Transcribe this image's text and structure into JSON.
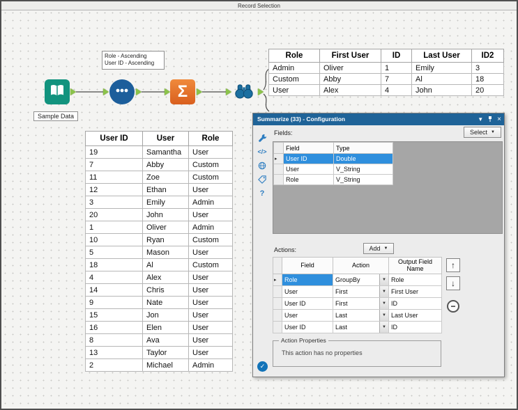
{
  "window": {
    "title": "Record Selection"
  },
  "workflow": {
    "input_tool_label": "Sample Data",
    "sort_annotation": "Role - Ascending\nUser ID - Ascending",
    "tools": [
      {
        "name": "input-data",
        "type": "Input Data"
      },
      {
        "name": "sort",
        "type": "Sort"
      },
      {
        "name": "summarize",
        "type": "Summarize"
      },
      {
        "name": "browse",
        "type": "Browse"
      }
    ]
  },
  "result_table": {
    "columns": [
      "Role",
      "First User",
      "ID",
      "Last User",
      "ID2"
    ],
    "rows": [
      [
        "Admin",
        "Oliver",
        "1",
        "Emily",
        "3"
      ],
      [
        "Custom",
        "Abby",
        "7",
        "Al",
        "18"
      ],
      [
        "User",
        "Alex",
        "4",
        "John",
        "20"
      ]
    ]
  },
  "data_table": {
    "columns": [
      "User ID",
      "User",
      "Role"
    ],
    "rows": [
      [
        "19",
        "Samantha",
        "User"
      ],
      [
        "7",
        "Abby",
        "Custom"
      ],
      [
        "11",
        "Zoe",
        "Custom"
      ],
      [
        "12",
        "Ethan",
        "User"
      ],
      [
        "3",
        "Emily",
        "Admin"
      ],
      [
        "20",
        "John",
        "User"
      ],
      [
        "1",
        "Oliver",
        "Admin"
      ],
      [
        "10",
        "Ryan",
        "Custom"
      ],
      [
        "5",
        "Mason",
        "User"
      ],
      [
        "18",
        "Al",
        "Custom"
      ],
      [
        "4",
        "Alex",
        "User"
      ],
      [
        "14",
        "Chris",
        "User"
      ],
      [
        "9",
        "Nate",
        "User"
      ],
      [
        "15",
        "Jon",
        "User"
      ],
      [
        "16",
        "Elen",
        "User"
      ],
      [
        "8",
        "Ava",
        "User"
      ],
      [
        "13",
        "Taylor",
        "User"
      ],
      [
        "2",
        "Michael",
        "Admin"
      ]
    ]
  },
  "config_panel": {
    "title": "Summarize (33) - Configuration",
    "fields_label": "Fields:",
    "select_button_label": "Select",
    "fields_table": {
      "columns": [
        "Field",
        "Type"
      ],
      "rows": [
        [
          "User ID",
          "Double"
        ],
        [
          "User",
          "V_String"
        ],
        [
          "Role",
          "V_String"
        ]
      ],
      "selected_row": 0
    },
    "actions_label": "Actions:",
    "add_button_label": "Add",
    "actions_table": {
      "columns": [
        "Field",
        "Action",
        "Output Field Name"
      ],
      "rows": [
        [
          "Role",
          "GroupBy",
          "Role"
        ],
        [
          "User",
          "First",
          "First User"
        ],
        [
          "User ID",
          "First",
          "ID"
        ],
        [
          "User",
          "Last",
          "Last User"
        ],
        [
          "User ID",
          "Last",
          "ID"
        ]
      ],
      "selected_row": 0
    },
    "action_properties_label": "Action Properties",
    "action_properties_text": "This action has no properties"
  },
  "icons": {
    "sigma": "Σ",
    "dropdown": "▼",
    "chevron_small": "▼",
    "close": "×",
    "move_up": "↑",
    "move_down": "↓",
    "remove": "−",
    "check": "✓",
    "help": "?",
    "code": "</>",
    "row_marker": "▸"
  },
  "colors": {
    "panel_header_blue": "#1f6398",
    "selection_blue": "#2f8fdd",
    "summarize_orange": "#e87722",
    "input_teal": "#12937e",
    "sort_blue": "#1c5e9b",
    "anchor_green": "#8bc34a"
  }
}
